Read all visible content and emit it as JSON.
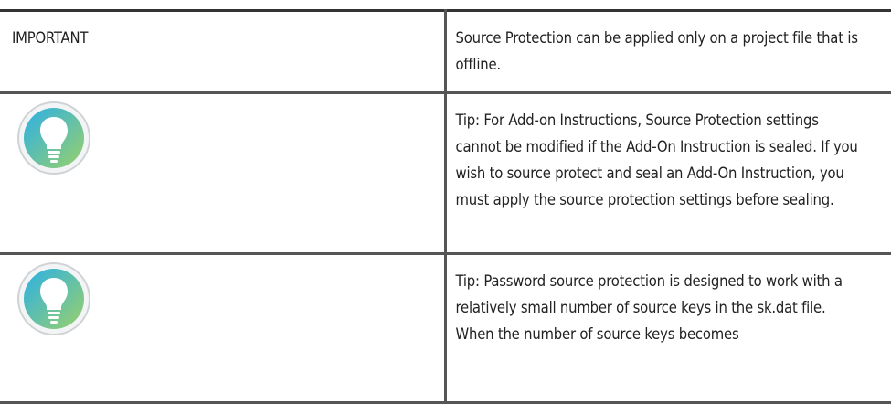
{
  "rows": [
    {
      "label": "IMPORTANT",
      "text": "Source Protection can be applied only on a project file that is offline."
    },
    {
      "icon": "lightbulb-icon",
      "text": "Tip: For Add-on Instructions, Source Protection settings cannot be modified if the Add-On Instruction is sealed. If you wish to source protect and seal an Add-On Instruction, you must apply the source protection settings before sealing."
    },
    {
      "icon": "lightbulb-icon",
      "text": "Tip: Password source protection is designed to work with a relatively small number of source keys in the sk.dat file. When the number of source keys becomes"
    }
  ],
  "colors": {
    "icon_ring_start": "#2bb0e6",
    "icon_ring_end": "#9ad06a",
    "icon_outline": "#cfd3d6",
    "rule": "#555555"
  }
}
